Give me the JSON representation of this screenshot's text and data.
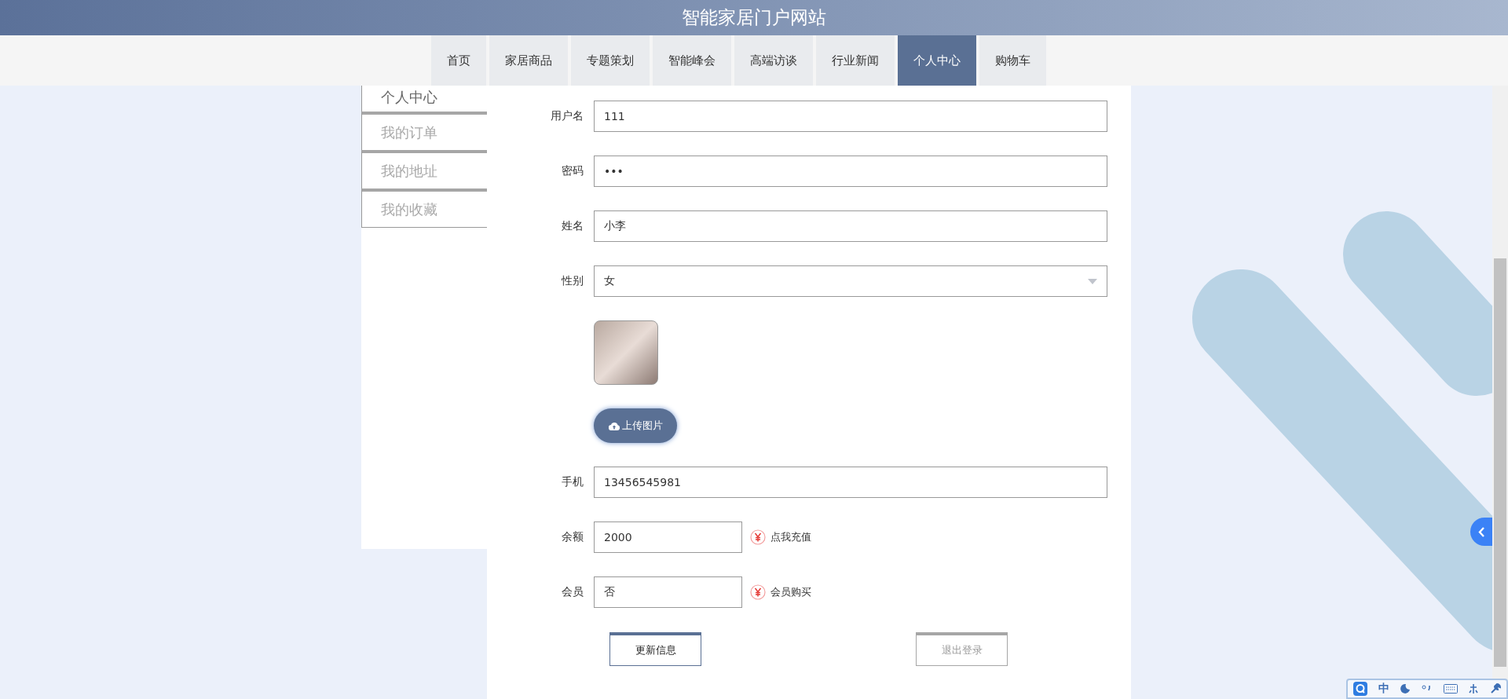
{
  "header": {
    "title": "智能家居门户网站"
  },
  "nav": [
    {
      "label": "首页",
      "selected": false
    },
    {
      "label": "家居商品",
      "selected": false
    },
    {
      "label": "专题策划",
      "selected": false
    },
    {
      "label": "智能峰会",
      "selected": false
    },
    {
      "label": "高端访谈",
      "selected": false
    },
    {
      "label": "行业新闻",
      "selected": false
    },
    {
      "label": "个人中心",
      "selected": true
    },
    {
      "label": "购物车",
      "selected": false
    }
  ],
  "sidebar": [
    {
      "label": "个人中心",
      "selected": true
    },
    {
      "label": "我的订单",
      "selected": false
    },
    {
      "label": "我的地址",
      "selected": false
    },
    {
      "label": "我的收藏",
      "selected": false
    }
  ],
  "form": [
    {
      "kind": "text",
      "label": "用户名",
      "value": "111"
    },
    {
      "kind": "text",
      "label": "密码",
      "value": "•••"
    },
    {
      "kind": "text",
      "label": "姓名",
      "value": "小李"
    },
    {
      "kind": "select",
      "label": "性别",
      "value": "女"
    },
    {
      "kind": "avatar"
    },
    {
      "kind": "upload",
      "label": "上传图片"
    },
    {
      "kind": "text",
      "label": "手机",
      "value": "13456545981"
    },
    {
      "kind": "short",
      "label": "余额",
      "value": "2000",
      "action": "点我充值"
    },
    {
      "kind": "short",
      "label": "会员",
      "value": "否",
      "action": "会员购买"
    }
  ],
  "buttons": [
    {
      "label": "更新信息",
      "kind": "primary"
    },
    {
      "label": "退出登录",
      "kind": "secondary"
    }
  ],
  "ime_toolbar": {
    "mode": "中"
  }
}
